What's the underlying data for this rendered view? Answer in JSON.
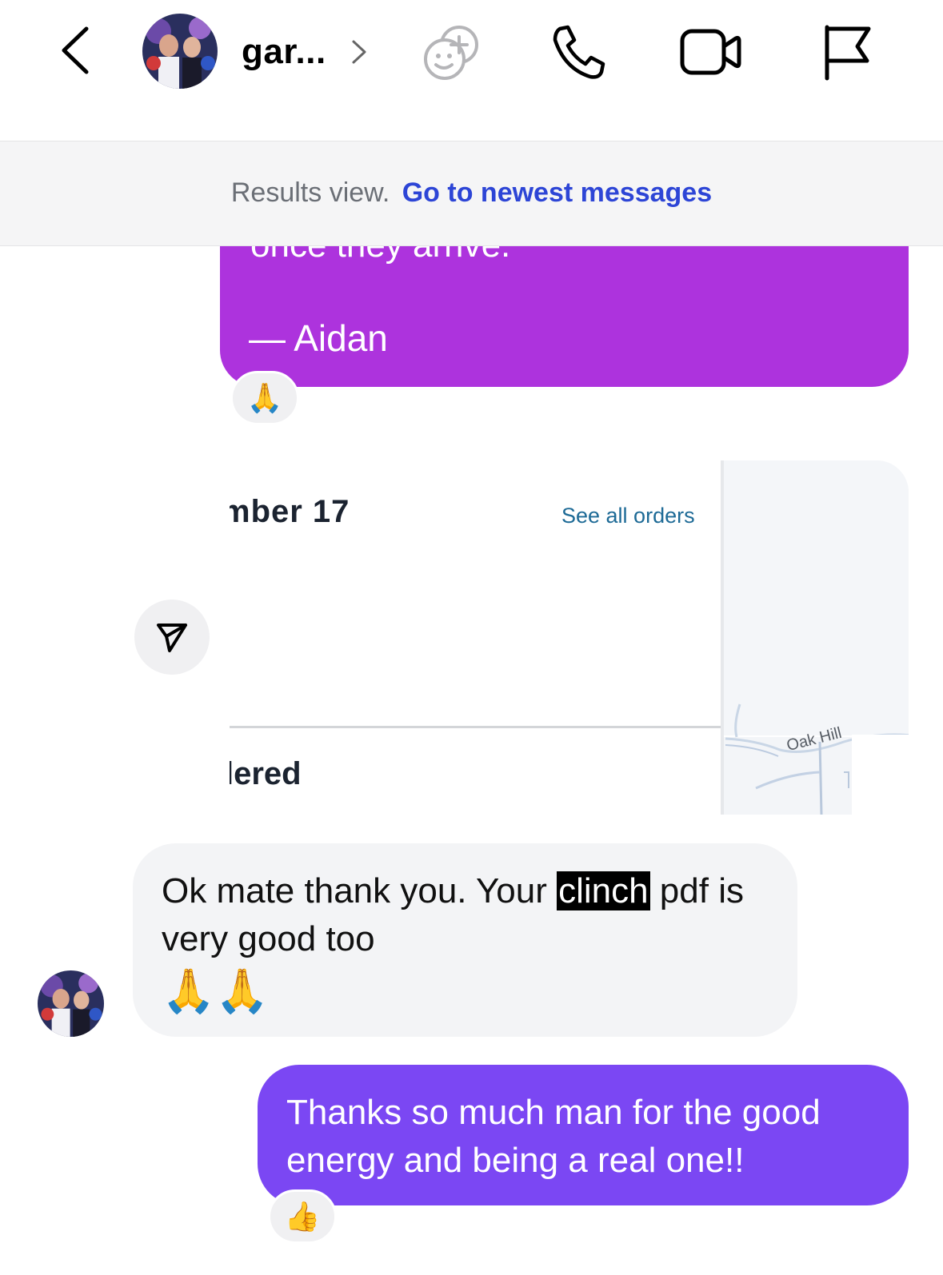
{
  "header": {
    "contact_name": "gar...",
    "icons": [
      "back-icon",
      "chevron-right-icon",
      "games-icon",
      "phone-icon",
      "video-icon",
      "flag-icon"
    ]
  },
  "results_banner": {
    "label": "Results view.",
    "link": "Go to newest messages"
  },
  "messages": [
    {
      "direction": "outgoing",
      "clipped_text": "once they arrive.",
      "signature": "— Aidan",
      "reaction": "🙏"
    },
    {
      "type": "shared_screenshot",
      "date_text": "mber 17",
      "link": "See all orders",
      "status_text": "lered",
      "map_label": "Oak Hill"
    },
    {
      "direction": "incoming",
      "text_before": "Ok mate thank you. Your ",
      "highlight": "clinch",
      "text_after": " pdf is very good too",
      "emoji": "🙏🙏"
    },
    {
      "direction": "outgoing",
      "text": "Thanks so much man for the good energy and being a real one!!",
      "reaction": "👍"
    }
  ],
  "colors": {
    "outgoing_bubble_top": "#ad33dd",
    "outgoing_bubble_bottom": "#7b47f3",
    "incoming_bubble": "#f3f4f6",
    "link_blue": "#2d45d6"
  }
}
